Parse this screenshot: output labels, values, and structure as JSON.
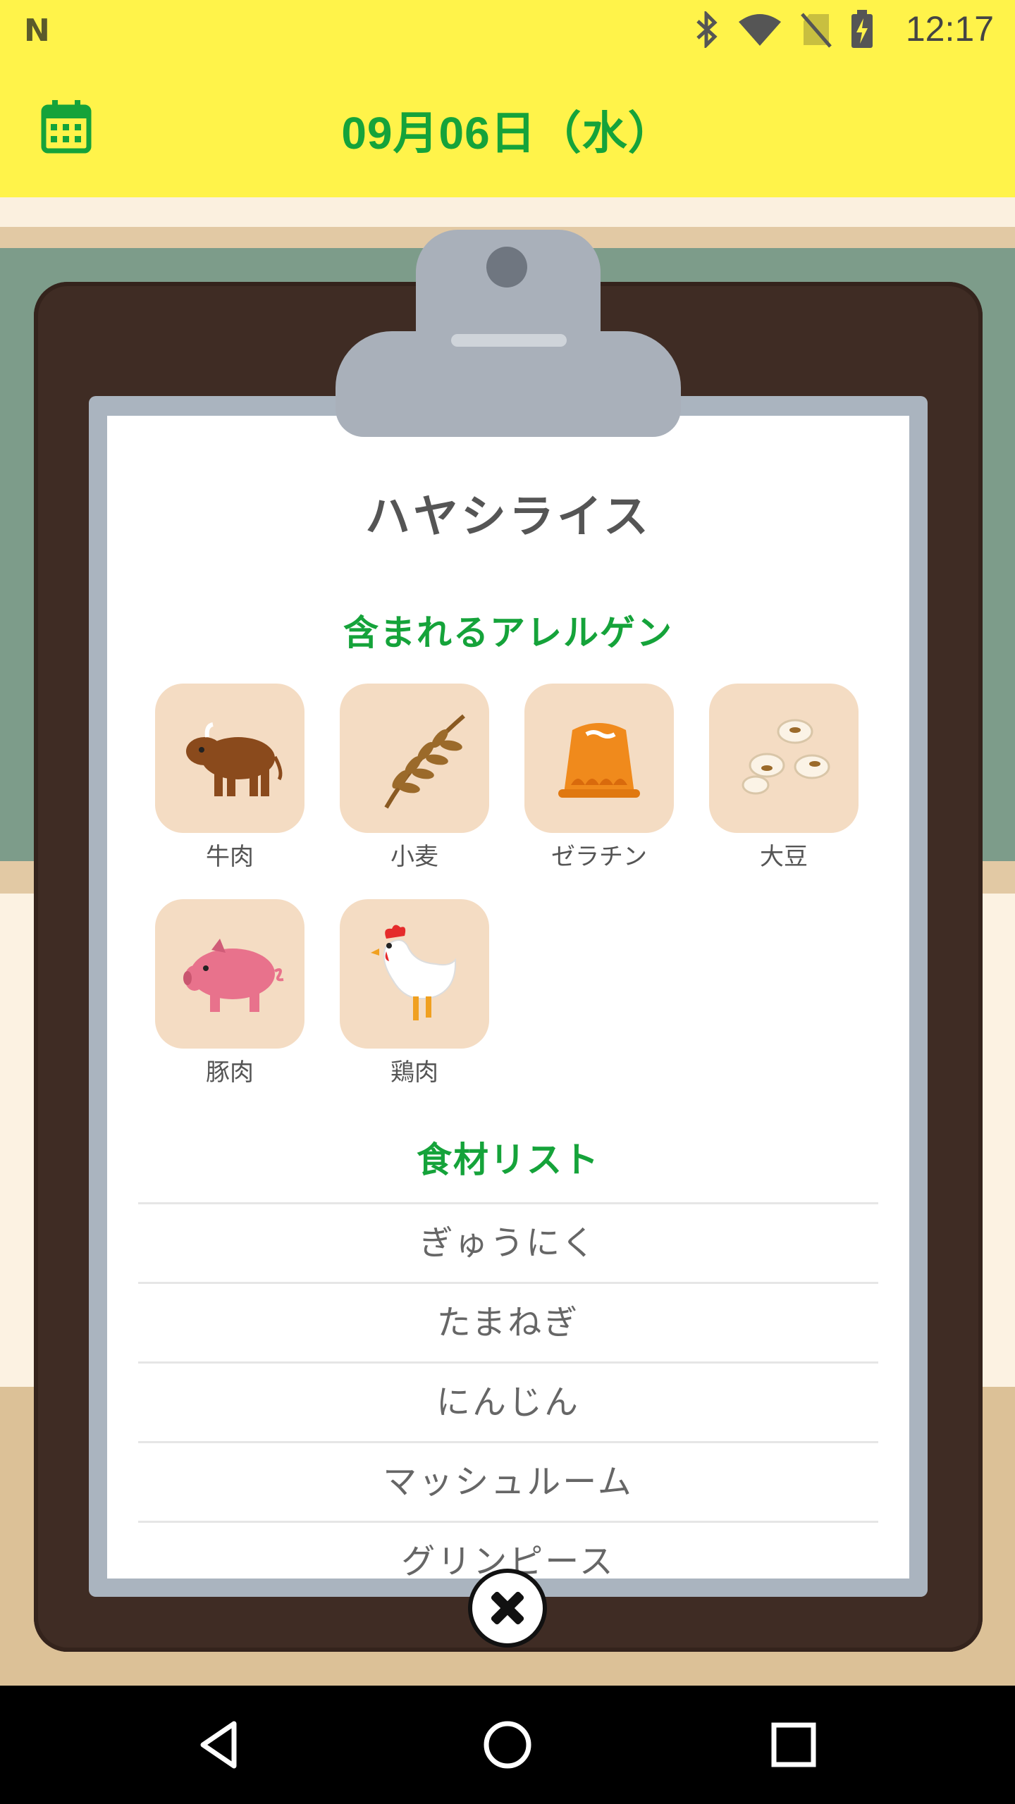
{
  "status_bar": {
    "time": "12:17",
    "icons": [
      "n-logo-icon",
      "bluetooth-icon",
      "wifi-icon",
      "no-sim-icon",
      "battery-charging-icon"
    ]
  },
  "header": {
    "title": "09月06日（水）",
    "calendar_icon": "calendar-icon"
  },
  "dish": {
    "name": "ハヤシライス"
  },
  "allergens": {
    "title": "含まれるアレルゲン",
    "items": [
      {
        "label": "牛肉",
        "icon": "cow-icon"
      },
      {
        "label": "小麦",
        "icon": "wheat-icon"
      },
      {
        "label": "ゼラチン",
        "icon": "jelly-icon"
      },
      {
        "label": "大豆",
        "icon": "soybean-icon"
      },
      {
        "label": "豚肉",
        "icon": "pig-icon"
      },
      {
        "label": "鶏肉",
        "icon": "chicken-icon"
      }
    ]
  },
  "ingredients": {
    "title": "食材リスト",
    "items": [
      "ぎゅうにく",
      "たまねぎ",
      "にんじん",
      "マッシュルーム",
      "グリンピース"
    ]
  },
  "colors": {
    "header_bg": "#fff34a",
    "accent_green": "#15a33a",
    "tile_bg": "#f4dcc3",
    "clipboard": "#3f2c24"
  },
  "nav": {
    "back": "back-icon",
    "home": "home-icon",
    "recents": "recents-icon"
  }
}
